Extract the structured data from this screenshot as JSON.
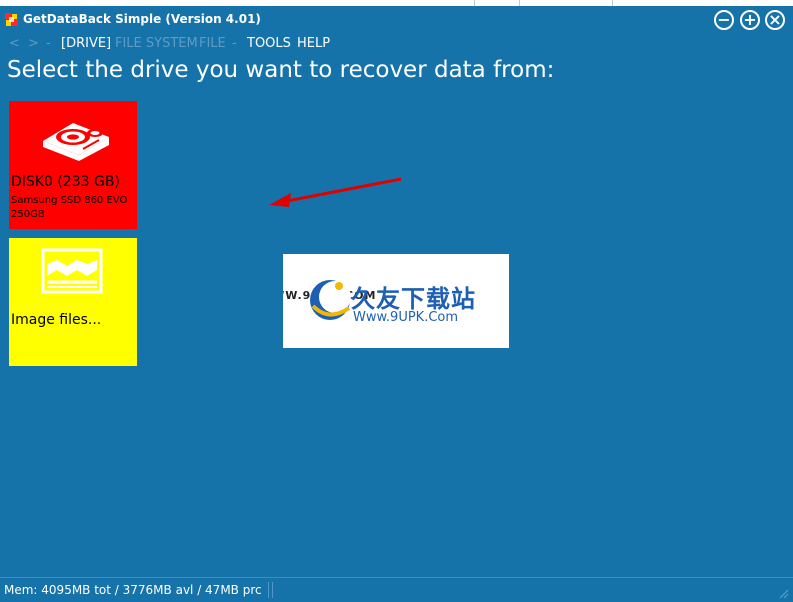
{
  "window": {
    "title": "GetDataBack Simple (Version 4.01)",
    "minimize_glyph": "−",
    "maximize_glyph": "+",
    "close_glyph": "×"
  },
  "menu": {
    "back": "<",
    "forward": ">",
    "separator": "-",
    "drive": "[DRIVE]",
    "file_system": "FILE SYSTEM",
    "file": "FILE",
    "separator2": "-",
    "tools": "TOOLS",
    "help": "HELP"
  },
  "main": {
    "heading": "Select the drive you want to recover data from:"
  },
  "drives": [
    {
      "name": "DISK0 (233 GB)",
      "model": "Samsung SSD 860 EVO 250GB",
      "icon": "hard-disk-icon",
      "color": "#ff0000"
    },
    {
      "name": "Image files...",
      "icon": "image-file-icon",
      "color": "#ffff00"
    }
  ],
  "watermark": {
    "url_small": "WWW.9UPK.COM",
    "brand": "久友下载站",
    "url": "Www.9UPK.Com"
  },
  "status": {
    "memory": "Mem: 4095MB tot / 3776MB avl / 47MB prc"
  },
  "colors": {
    "background": "#1573aa",
    "menu_disabled": "#5e9cc4",
    "arrow": "#e00000"
  }
}
